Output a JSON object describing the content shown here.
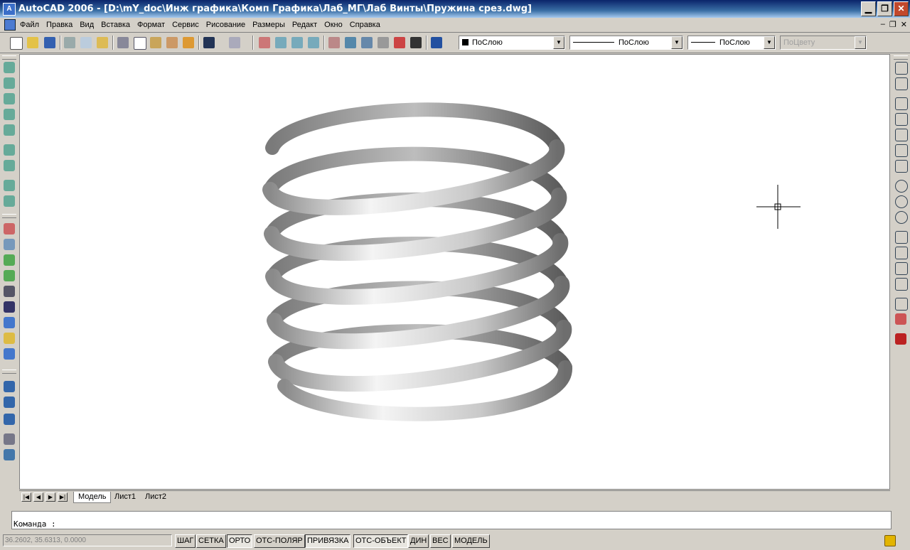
{
  "window": {
    "title": "AutoCAD 2006 - [D:\\mY_doc\\Инж графика\\Комп Графика\\Лаб_МГ\\Лаб Винты\\Пружина срез.dwg]",
    "app_icon": "A",
    "minimize": "▁",
    "restore": "❐",
    "close": "✕"
  },
  "menu": {
    "items": [
      "Файл",
      "Правка",
      "Вид",
      "Вставка",
      "Формат",
      "Сервис",
      "Рисование",
      "Размеры",
      "Редакт",
      "Окно",
      "Справка"
    ],
    "mdi_minimize": "–",
    "mdi_restore": "❐",
    "mdi_close": "✕"
  },
  "toolbar": {
    "layer_combo": "ПоСлою",
    "linetype_combo": "ПоСлою",
    "lineweight_combo": "ПоСлою",
    "plotstyle_combo": "ПоЦвету",
    "combo_arrow": "▼"
  },
  "layout_tabs": {
    "nav": [
      "|◀",
      "◀",
      "▶",
      "▶|"
    ],
    "tabs": [
      "Модель",
      "Лист1",
      "Лист2"
    ]
  },
  "command": {
    "prompt": "Команда :"
  },
  "status": {
    "coords": "36.2602, 35.6313, 0.0000",
    "buttons": [
      {
        "label": "ШАГ",
        "state": "up"
      },
      {
        "label": "СЕТКА",
        "state": "up"
      },
      {
        "label": "ОРТО",
        "state": "down"
      },
      {
        "label": "ОТС-ПОЛЯР",
        "state": "up"
      },
      {
        "label": "ПРИВЯЗКА",
        "state": "down"
      },
      {
        "label": "ОТС-ОБЪЕКТ",
        "state": "down"
      },
      {
        "label": "ДИН",
        "state": "up"
      },
      {
        "label": "ВЕС",
        "state": "up"
      },
      {
        "label": "МОДЕЛЬ",
        "state": "up"
      }
    ],
    "lock_icon": "lock-icon"
  },
  "colors": {
    "title_start": "#0a246a",
    "title_end": "#a6caf0",
    "chrome": "#d4d0c8",
    "canvas": "#ffffff"
  }
}
